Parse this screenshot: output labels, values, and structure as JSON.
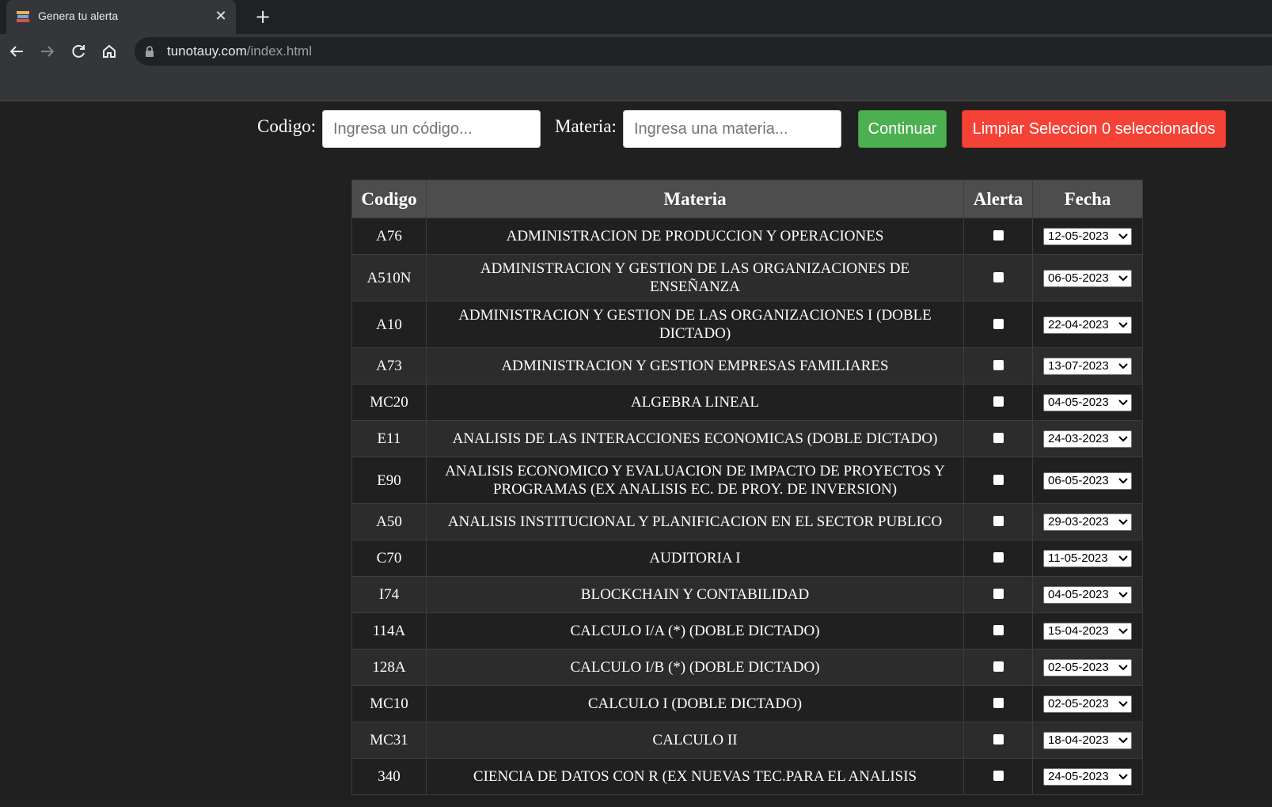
{
  "browser": {
    "tab_title": "Genera tu alerta",
    "url_host": "tunotauy.com",
    "url_path": "/index.html"
  },
  "search": {
    "codigo_label": "Codigo:",
    "codigo_placeholder": "Ingresa un código...",
    "materia_label": "Materia:",
    "materia_placeholder": "Ingresa una materia...",
    "continue_label": "Continuar",
    "clear_label": "Limpiar Seleccion 0 seleccionados"
  },
  "table": {
    "headers": [
      "Codigo",
      "Materia",
      "Alerta",
      "Fecha"
    ],
    "rows": [
      {
        "codigo": "A76",
        "materia": "ADMINISTRACION DE PRODUCCION Y OPERACIONES",
        "checked": false,
        "fecha": "12-05-2023"
      },
      {
        "codigo": "A510N",
        "materia": "ADMINISTRACION Y GESTION DE LAS ORGANIZACIONES DE ENSEÑANZA",
        "checked": false,
        "fecha": "06-05-2023"
      },
      {
        "codigo": "A10",
        "materia": "ADMINISTRACION Y GESTION DE LAS ORGANIZACIONES I (DOBLE DICTADO)",
        "checked": false,
        "fecha": "22-04-2023"
      },
      {
        "codigo": "A73",
        "materia": "ADMINISTRACION Y GESTION EMPRESAS FAMILIARES",
        "checked": false,
        "fecha": "13-07-2023"
      },
      {
        "codigo": "MC20",
        "materia": "ALGEBRA LINEAL",
        "checked": false,
        "fecha": "04-05-2023"
      },
      {
        "codigo": "E11",
        "materia": "ANALISIS DE LAS INTERACCIONES ECONOMICAS (DOBLE DICTADO)",
        "checked": false,
        "fecha": "24-03-2023"
      },
      {
        "codigo": "E90",
        "materia": "ANALISIS ECONOMICO Y EVALUACION DE IMPACTO DE PROYECTOS Y PROGRAMAS (EX ANALISIS EC. DE PROY. DE INVERSION)",
        "checked": false,
        "fecha": "06-05-2023"
      },
      {
        "codigo": "A50",
        "materia": "ANALISIS INSTITUCIONAL Y PLANIFICACION EN EL SECTOR PUBLICO",
        "checked": false,
        "fecha": "29-03-2023"
      },
      {
        "codigo": "C70",
        "materia": "AUDITORIA I",
        "checked": false,
        "fecha": "11-05-2023"
      },
      {
        "codigo": "I74",
        "materia": "BLOCKCHAIN Y CONTABILIDAD",
        "checked": false,
        "fecha": "04-05-2023"
      },
      {
        "codigo": "114A",
        "materia": "CALCULO I/A (*) (DOBLE DICTADO)",
        "checked": false,
        "fecha": "15-04-2023"
      },
      {
        "codigo": "128A",
        "materia": "CALCULO I/B  (*) (DOBLE DICTADO)",
        "checked": false,
        "fecha": "02-05-2023"
      },
      {
        "codigo": "MC10",
        "materia": "CALCULO I (DOBLE DICTADO)",
        "checked": false,
        "fecha": "02-05-2023"
      },
      {
        "codigo": "MC31",
        "materia": "CALCULO II",
        "checked": false,
        "fecha": "18-04-2023"
      },
      {
        "codigo": "340",
        "materia": "CIENCIA DE DATOS CON R (EX NUEVAS TEC.PARA EL ANALISIS",
        "checked": false,
        "fecha": "24-05-2023"
      }
    ]
  },
  "icons": {
    "back": "arrow-left-icon",
    "forward": "arrow-right-icon",
    "reload": "reload-icon",
    "home": "home-icon",
    "lock": "lock-icon",
    "close": "close-icon",
    "new_tab": "plus-icon",
    "select_arrow": "chevron-down-icon"
  },
  "colors": {
    "page_bg": "#202020",
    "header_bg": "#4d4d4d",
    "continue_bg": "#4caf50",
    "clear_bg": "#f44336"
  }
}
